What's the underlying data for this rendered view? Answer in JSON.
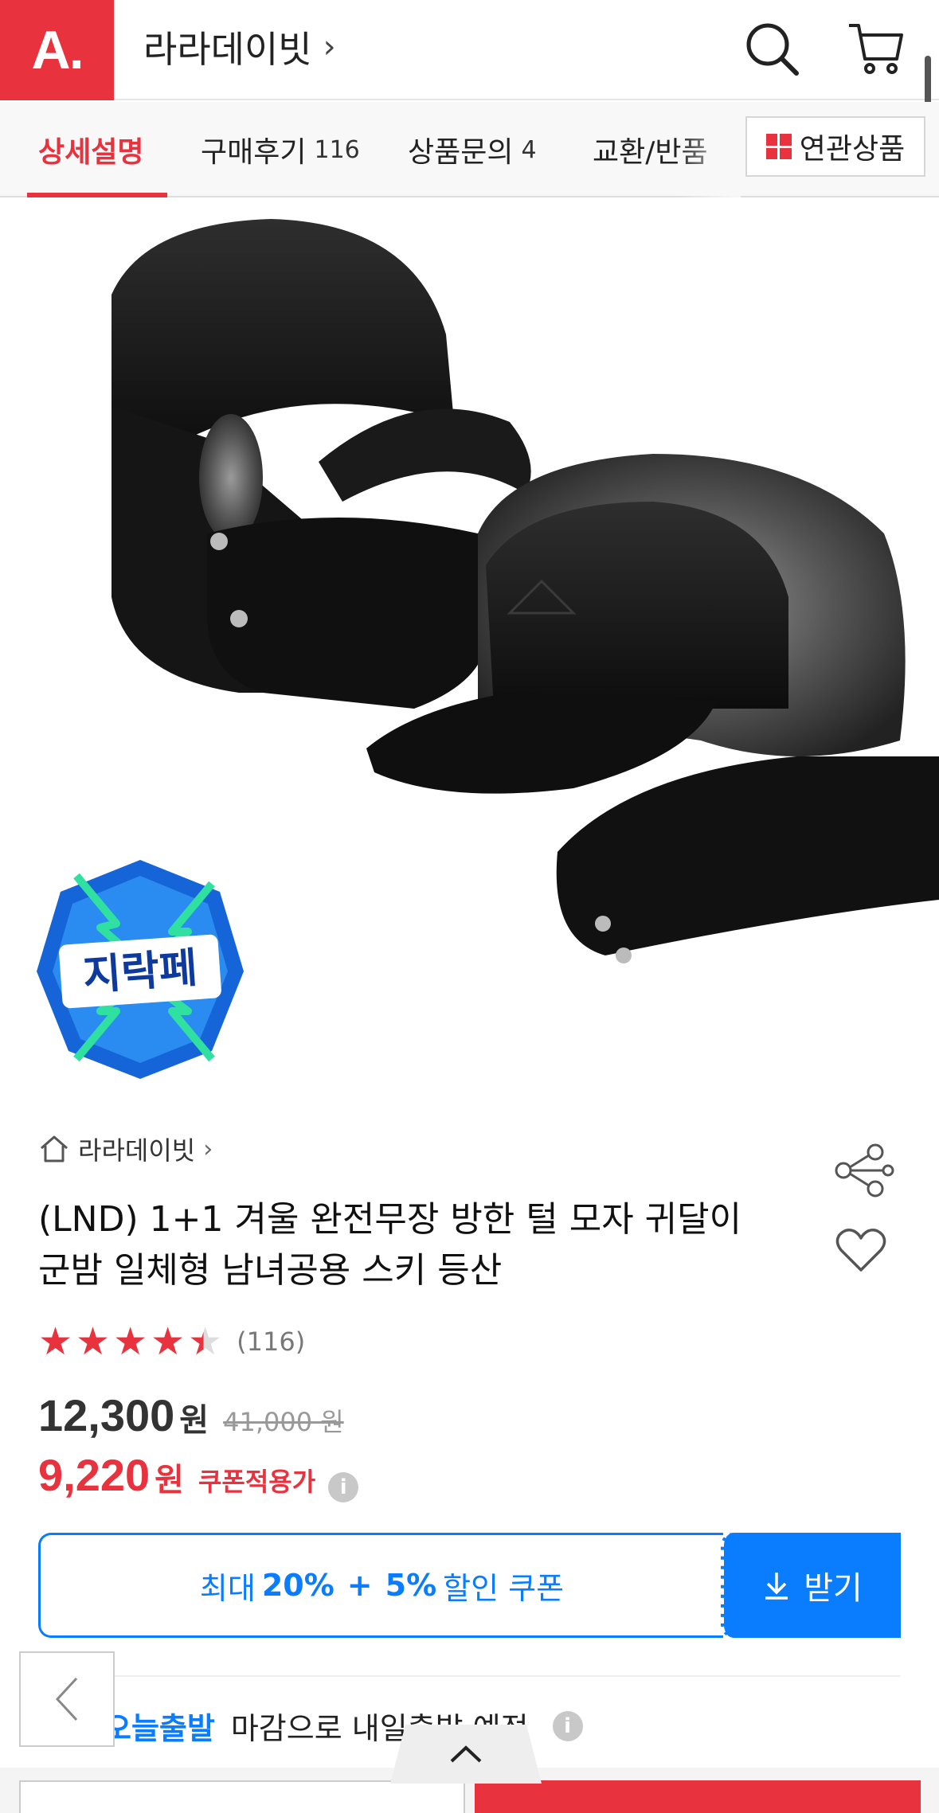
{
  "header": {
    "logo_text": "A.",
    "store_title": "라라데이빗",
    "chevron": "›",
    "search_icon": "search-icon",
    "cart_icon": "cart-icon"
  },
  "tabs": [
    {
      "label": "상세설명",
      "count": ""
    },
    {
      "label": "구매후기",
      "count": "116"
    },
    {
      "label": "상품문의",
      "count": "4"
    },
    {
      "label": "교환/반품",
      "count": ""
    }
  ],
  "related_button": {
    "label": "연관상품",
    "icon": "grid-icon"
  },
  "badge_text": "지락페",
  "product": {
    "store_link": "라라데이빗",
    "title_line1": "(LND) 1+1 겨울 완전무장 방한 털 모자 귀달이",
    "title_line2": "군밤 일체형 남녀공용 스키 등산",
    "rating_value": 4.5,
    "rating_max": 5,
    "review_count": "(116)",
    "price": "12,300",
    "price_unit": "원",
    "original_price": "41,000 원",
    "coupon_price": "9,220",
    "coupon_price_unit": "원",
    "coupon_label": "쿠폰적용가",
    "info_icon": "i"
  },
  "coupon": {
    "prefix": "최대",
    "discount1": "20%",
    "plus": "+",
    "discount2": "5%",
    "suffix": "할인 쿠폰",
    "get_label": "받기"
  },
  "delivery": {
    "today_label": "오늘출발",
    "text": "마감으로 내일출발 예정"
  },
  "colors": {
    "brand_red": "#e8323d",
    "accent_blue": "#0a7dff"
  }
}
